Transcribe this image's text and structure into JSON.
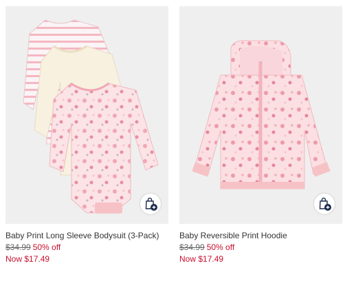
{
  "colors": {
    "sale_red": "#c8102e",
    "image_bg": "#efefef",
    "pink": "#f6c2c6",
    "cream": "#f8f1e0",
    "bag_navy": "#1b2a4a"
  },
  "products": [
    {
      "name": "Baby Print Long Sleeve Bodysuit (3-Pack)",
      "original_price": "$34.99",
      "discount": "50% off",
      "sale_price": "Now $17.49",
      "bag_icon": "shopping-bag-plus-icon"
    },
    {
      "name": "Baby Reversible Print Hoodie",
      "original_price": "$34.99",
      "discount": "50% off",
      "sale_price": "Now $17.49",
      "bag_icon": "shopping-bag-plus-icon"
    }
  ]
}
